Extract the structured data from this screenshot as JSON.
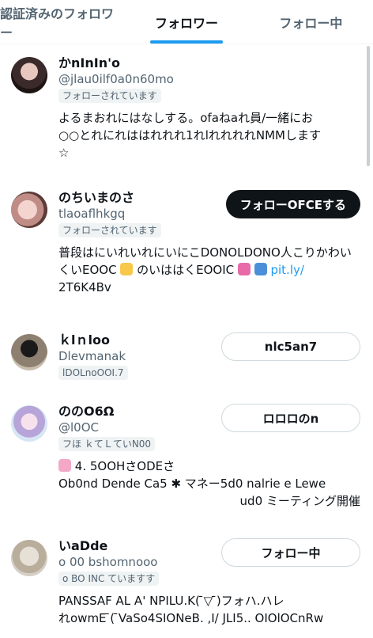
{
  "tabs": [
    {
      "label": "認証済みのフォロワー"
    },
    {
      "label": "フォロワー"
    },
    {
      "label": "フォロー中"
    }
  ],
  "users": [
    {
      "name": "かnInIn'o",
      "handle": "@jlau0ilf0a0n60mo",
      "follows_you": "フォローされています",
      "bio": "よるまおれにはなしする。ofaねaれ員/一緒にお",
      "bio2": "○○とれにれははれれれ1れlれれれれNMMします",
      "bio3": "☆",
      "button": ""
    },
    {
      "name": "のちいまのさ",
      "handle": "tlaoaflhkgq",
      "follows_you": "フォローされています",
      "bio": "普段はにいれいれにいにこDONOLDONO人こりかわい",
      "bio2": "くいEOOC",
      "bio2b": "のいははくEOOIC",
      "link": "pit.ly/",
      "bio3": "2T6K4Bv",
      "button": "フォローOFCEする"
    },
    {
      "name": "ｋlｎloo",
      "handle": "Dlevmanak",
      "follows_you": "lDOLnoOOI.7",
      "bio": "",
      "button": "nlc5an7"
    },
    {
      "name": "ののO6Ω",
      "handle": "@l0OC",
      "follows_you": "フほ ｋてＬていN00",
      "bio": "4. 5OOHさODEさ",
      "bio2": "Ob0nd Dende Ca5 ✱ マネー5d0 nalrie e Lewe",
      "bio3": "ud0 ミーティング開催",
      "button": "ロロロのn"
    },
    {
      "name": "いaDde",
      "handle": "o 00 bshomnooo",
      "follows_you": "o BO INC ていますす",
      "bio": "PANSSAF AL A' NPILU.K( ̄▽ ̄)フォハ.ハレ",
      "bio2": "れowmE ̄( ̄VaSo4SIONeB. ,I/ JLI5.. OIOlOCnRw",
      "button": "フォロー中"
    }
  ],
  "colors": {
    "accent": "#1d9bf0",
    "text": "#0f1419",
    "secondary": "#536471",
    "dark_button": "#0f1419"
  }
}
